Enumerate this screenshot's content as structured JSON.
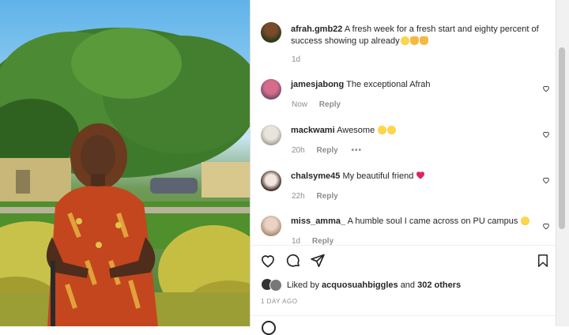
{
  "post": {
    "caption": {
      "username": "afrah.gmb22",
      "text": "A fresh week for a fresh start and eighty percent of success showing up already",
      "time": "1d"
    },
    "comments": [
      {
        "username": "jamesjabong",
        "text": "The exceptional Afrah",
        "time": "Now",
        "reply": "Reply",
        "emoji": ""
      },
      {
        "username": "mackwami",
        "text": "Awesome",
        "time": "20h",
        "reply": "Reply",
        "more": "•••"
      },
      {
        "username": "chalsyme45",
        "text": "My beautiful friend",
        "time": "22h",
        "reply": "Reply"
      },
      {
        "username": "miss_amma_",
        "text": "A humble soul I came across on PU campus",
        "time": "1d",
        "reply": "Reply"
      }
    ],
    "likes": {
      "prefix": "Liked by",
      "user": "acquosuahbiggles",
      "suffix": "and",
      "others": "302 others"
    },
    "date": "1 DAY AGO"
  },
  "icons": [
    "heart-icon",
    "comment-icon",
    "share-icon",
    "bookmark-icon"
  ],
  "colors": {
    "like_red": "#e0245e",
    "muted": "#8e8e8e",
    "text": "#262626"
  }
}
